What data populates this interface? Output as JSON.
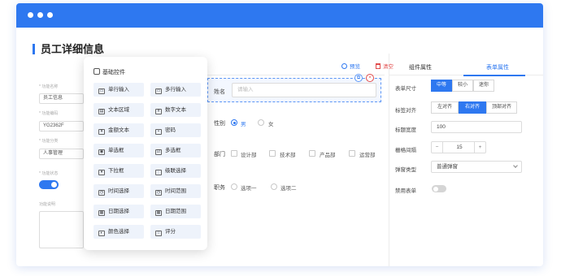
{
  "window": {
    "accent": "#2e78f0"
  },
  "page": {
    "title": "员工详细信息"
  },
  "left_form": {
    "fields": [
      {
        "label": "* 功能名称",
        "value": "员工信息"
      },
      {
        "label": "* 功能编码",
        "value": "YG2362F"
      },
      {
        "label": "* 功能分类",
        "value": "人事管理"
      },
      {
        "label": "* 功能状态",
        "value": ""
      },
      {
        "label": "功能说明",
        "value": ""
      }
    ]
  },
  "toolbar": {
    "preview": "预览",
    "clear": "清空"
  },
  "canvas": {
    "name_label": "姓名",
    "name_placeholder": "请输入",
    "gender_label": "性别",
    "gender_options": [
      "男",
      "女"
    ],
    "dept_label": "部门",
    "dept_options": [
      "设计部",
      "技术部",
      "产品部",
      "运营部"
    ],
    "position_label": "职务",
    "position_options": [
      "选项一",
      "选项二"
    ]
  },
  "components": {
    "title": "基础控件",
    "items": [
      {
        "label": "单行输入",
        "icon": "single-line-input-icon"
      },
      {
        "label": "多行输入",
        "icon": "multi-line-input-icon"
      },
      {
        "label": "文本区域",
        "icon": "text-area-icon"
      },
      {
        "label": "数字文本",
        "icon": "number-text-icon"
      },
      {
        "label": "金额文本",
        "icon": "amount-text-icon"
      },
      {
        "label": "密码",
        "icon": "password-icon"
      },
      {
        "label": "单选框",
        "icon": "radio-icon"
      },
      {
        "label": "多选框",
        "icon": "checkbox-icon"
      },
      {
        "label": "下拉框",
        "icon": "dropdown-icon"
      },
      {
        "label": "级联选择",
        "icon": "cascader-icon"
      },
      {
        "label": "时间选择",
        "icon": "time-picker-icon"
      },
      {
        "label": "时间范围",
        "icon": "time-range-icon"
      },
      {
        "label": "日期选择",
        "icon": "date-picker-icon"
      },
      {
        "label": "日期范围",
        "icon": "date-range-icon"
      },
      {
        "label": "颜色选择",
        "icon": "color-picker-icon"
      },
      {
        "label": "评分",
        "icon": "rating-icon"
      }
    ]
  },
  "props": {
    "tabs": [
      "组件属性",
      "表单属性"
    ],
    "active_tab": "表单属性",
    "form_size_label": "表单尺寸",
    "form_size_options": [
      "中等",
      "较小",
      "迷你"
    ],
    "label_align_label": "标签对齐",
    "label_align_options": [
      "左对齐",
      "右对齐",
      "顶部对齐"
    ],
    "label_width_label": "标题宽度",
    "label_width_value": "100",
    "grid_gap_label": "栅格间隔",
    "grid_gap_value": "15",
    "grid_minus": "−",
    "grid_plus": "+",
    "dialog_type_label": "弹窗类型",
    "dialog_type_value": "普通弹窗",
    "disable_form_label": "禁用表单"
  }
}
